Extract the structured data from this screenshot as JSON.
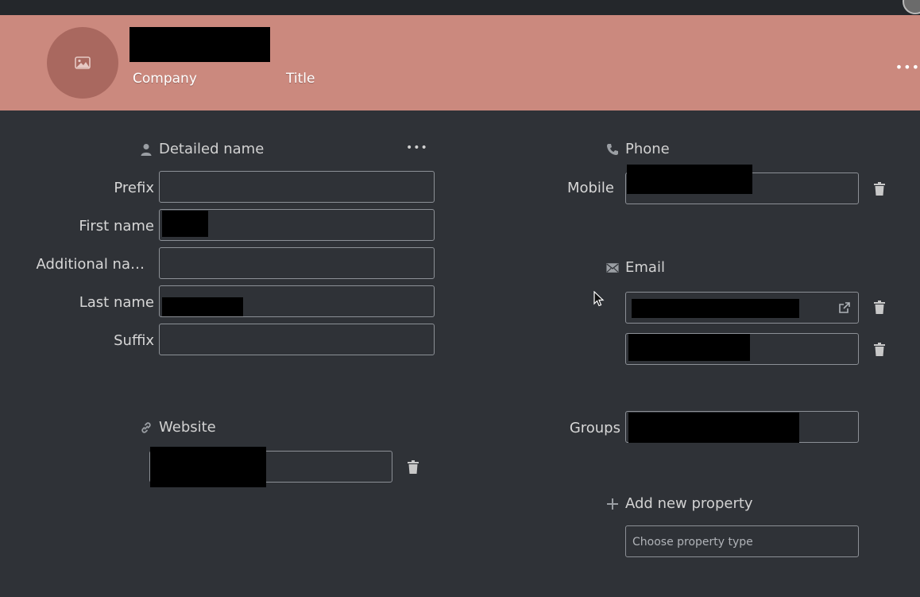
{
  "header": {
    "company_label": "Company",
    "title_label": "Title",
    "more_label": "•••",
    "accent_color": "#cb897e"
  },
  "detailed_name": {
    "section_title": "Detailed name",
    "icon": "person-icon",
    "more_label": "•••",
    "fields": [
      {
        "label": "Prefix",
        "value": ""
      },
      {
        "label": "First name",
        "value": ""
      },
      {
        "label": "Additional na…",
        "value": ""
      },
      {
        "label": "Last name",
        "value": ""
      },
      {
        "label": "Suffix",
        "value": ""
      }
    ]
  },
  "website": {
    "section_title": "Website",
    "icon": "link-icon"
  },
  "phone": {
    "section_title": "Phone",
    "icon": "phone-icon",
    "mobile_label": "Mobile"
  },
  "email": {
    "section_title": "Email",
    "icon": "envelope-icon"
  },
  "groups": {
    "label": "Groups"
  },
  "add_property": {
    "label": "Add new property",
    "icon": "plus-icon",
    "placeholder": "Choose property type"
  }
}
